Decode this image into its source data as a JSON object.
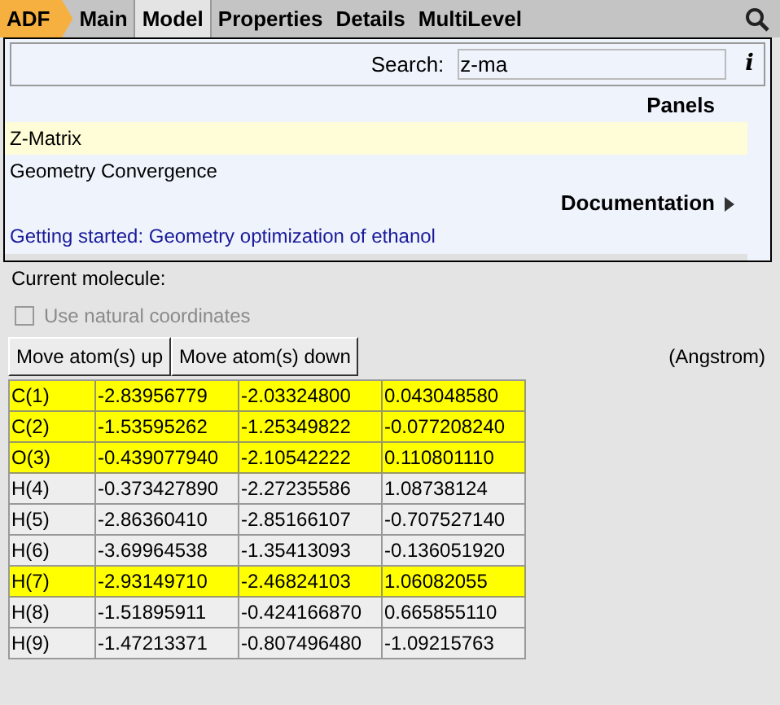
{
  "menu_bar": {
    "logo": "ADF",
    "tabs": [
      {
        "label": "Main",
        "selected": false
      },
      {
        "label": "Model",
        "selected": true
      },
      {
        "label": "Properties",
        "selected": false
      },
      {
        "label": "Details",
        "selected": false
      },
      {
        "label": "MultiLevel",
        "selected": false
      }
    ]
  },
  "search_popup": {
    "label": "Search:",
    "value": "z-ma",
    "info": "i",
    "sections": [
      {
        "title": "Panels",
        "arrow": false,
        "items": [
          {
            "label": "Z-Matrix",
            "kind": "panel",
            "selected": true
          },
          {
            "label": "Geometry Convergence",
            "kind": "panel",
            "selected": false
          }
        ]
      },
      {
        "title": "Documentation",
        "arrow": true,
        "items": [
          {
            "label": "Getting started: Geometry optimization of ethanol",
            "kind": "link",
            "selected": false
          }
        ]
      }
    ]
  },
  "current_molecule_label": "Current molecule:",
  "natural_coordinates": {
    "label": "Use natural coordinates",
    "checked": false,
    "disabled": true
  },
  "buttons": [
    "Move atom(s) up",
    "Move atom(s) down"
  ],
  "units": "(Angstrom)",
  "atoms": [
    {
      "cells": [
        "C(1)",
        "-2.83956779",
        "-2.03324800",
        "0.043048580"
      ],
      "selected": true
    },
    {
      "cells": [
        "C(2)",
        "-1.53595262",
        "-1.25349822",
        "-0.077208240"
      ],
      "selected": true
    },
    {
      "cells": [
        "O(3)",
        "-0.439077940",
        "-2.10542222",
        "0.110801110"
      ],
      "selected": true
    },
    {
      "cells": [
        "H(4)",
        "-0.373427890",
        "-2.27235586",
        "1.08738124"
      ],
      "selected": false
    },
    {
      "cells": [
        "H(5)",
        "-2.86360410",
        "-2.85166107",
        "-0.707527140"
      ],
      "selected": false
    },
    {
      "cells": [
        "H(6)",
        "-3.69964538",
        "-1.35413093",
        "-0.136051920"
      ],
      "selected": false
    },
    {
      "cells": [
        "H(7)",
        "-2.93149710",
        "-2.46824103",
        "1.06082055"
      ],
      "selected": true
    },
    {
      "cells": [
        "H(8)",
        "-1.51895911",
        "-0.424166870",
        "0.665855110"
      ],
      "selected": false
    },
    {
      "cells": [
        "H(9)",
        "-1.47213371",
        "-0.807496480",
        "-1.09215763"
      ],
      "selected": false
    }
  ]
}
